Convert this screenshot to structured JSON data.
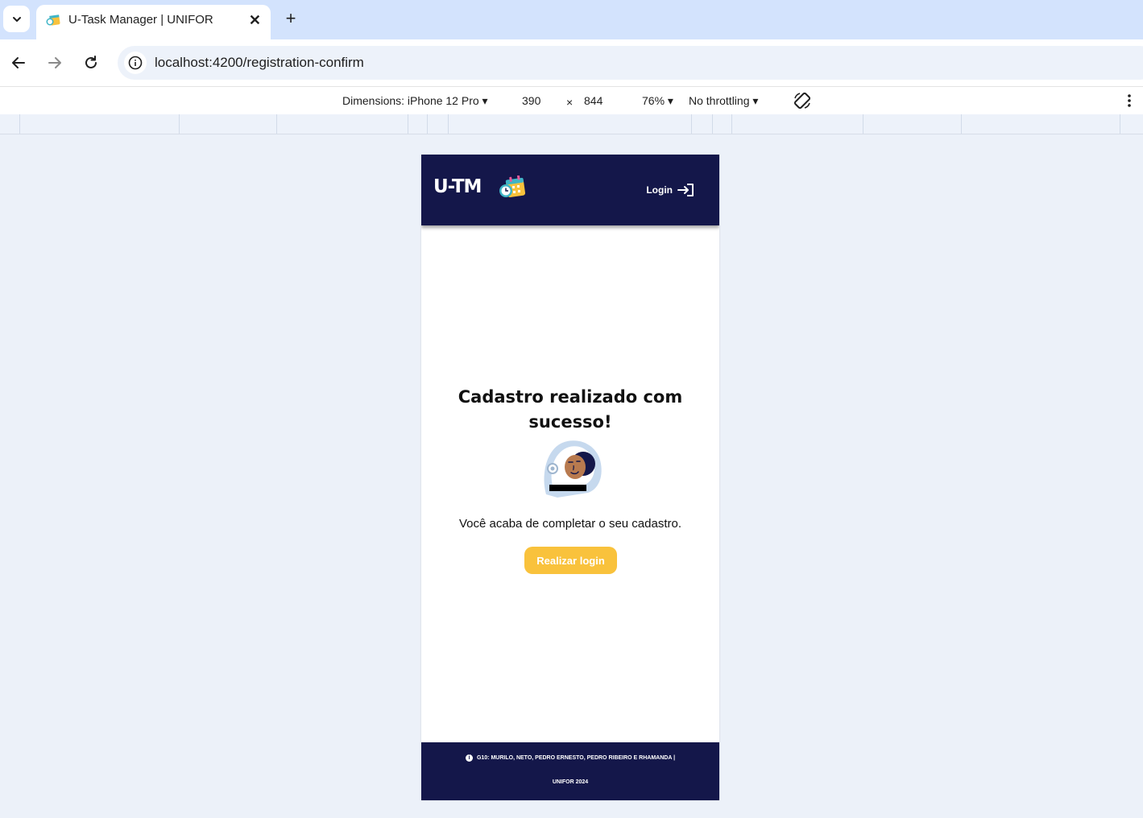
{
  "browser": {
    "tab": {
      "title": "U-Task Manager | UNIFOR",
      "close_glyph": "✕"
    },
    "new_tab_glyph": "+",
    "url": "localhost:4200/registration-confirm"
  },
  "devtools": {
    "dimensions_label": "Dimensions: iPhone 12 Pro",
    "width": "390",
    "times": "×",
    "height": "844",
    "zoom": "76%",
    "throttling": "No throttling",
    "caret": "▾"
  },
  "app": {
    "brand": "U-TM",
    "login_label": "Login",
    "title_line1": "Cadastro realizado com",
    "title_line2": "sucesso!",
    "message": "Você acaba de completar o seu cadastro.",
    "cta_label": "Realizar login",
    "footer_line1": "G10: MURILO, NETO, PEDRO ERNESTO, PEDRO RIBEIRO E RHAMANDA |",
    "footer_line2": "UNIFOR 2024",
    "footer_info_glyph": "i",
    "colors": {
      "header_bg": "#14174a",
      "accent": "#f9c23c",
      "page_bg": "#ecf1f9"
    }
  },
  "icons": [
    "chevron-down-icon",
    "favicon-calendar-icon",
    "close-icon",
    "plus-icon",
    "back-arrow-icon",
    "forward-arrow-icon",
    "reload-icon",
    "info-icon",
    "rotate-icon",
    "kebab-menu-icon",
    "calendar-logo-icon",
    "login-arrow-icon",
    "astronaut-illustration"
  ]
}
